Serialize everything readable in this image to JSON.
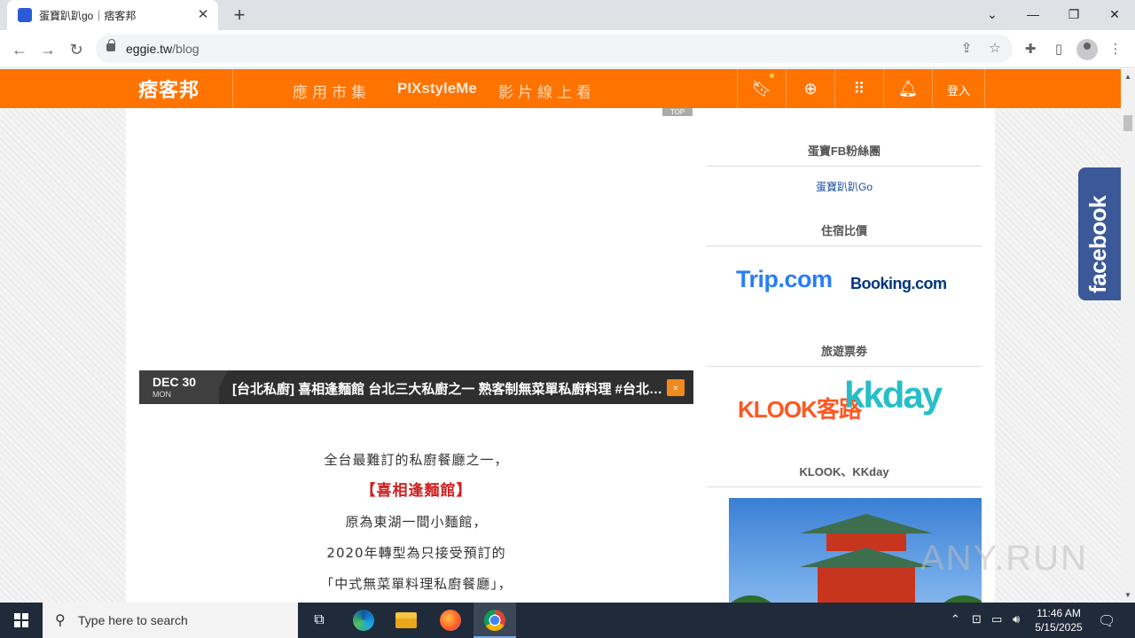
{
  "browser": {
    "tab_title": "蛋寶趴趴go｜痞客邦",
    "tab_close": "✕",
    "new_tab": "+",
    "url_domain": "eggie.tw",
    "url_path": "/blog",
    "window_controls": {
      "dropdown": "⌄",
      "minimize": "—",
      "restore": "❐",
      "close": "✕"
    }
  },
  "site_header": {
    "logo": "痞客邦",
    "nav": [
      "應用市集",
      "PIXstyleMe",
      "影片線上看"
    ],
    "login": "登入"
  },
  "post": {
    "top_badge": "TOP",
    "date_main": "DEC 30",
    "date_day": "MON",
    "title": "[台北私廚] 喜相逢麵館 台北三大私廚之一 熟客制無菜單私廚料理 #台北私廚 #台北無菜單料理",
    "action_icon": "⌅",
    "lines": [
      "全台最難訂的私廚餐廳之一，",
      "【喜相逢麵館】",
      "原為東湖一間小麵館，",
      "2020年轉型為只接受預訂的",
      "「中式無菜單料理私廚餐廳」，"
    ]
  },
  "sidebar": {
    "fb_group_heading": "蛋寶FB粉絲團",
    "fb_group_link": "蛋寶趴趴Go",
    "hotel_heading": "住宿比價",
    "trip_logo": "Trip.com",
    "booking_logo": "Booking.com",
    "tickets_heading": "旅遊票劵",
    "klook_logo": "KLOOK客路",
    "kkday_logo": "kkday",
    "klook_kkday_heading": "KLOOK、KKday"
  },
  "facebook_tab": "facebook",
  "watermark": "ANY.RUN",
  "taskbar": {
    "search_placeholder": "Type here to search",
    "time": "11:46 AM",
    "date": "5/15/2025"
  },
  "colors": {
    "pixnet_orange": "#ff7300",
    "facebook_blue": "#3b5998",
    "article_red": "#d01f1f"
  }
}
